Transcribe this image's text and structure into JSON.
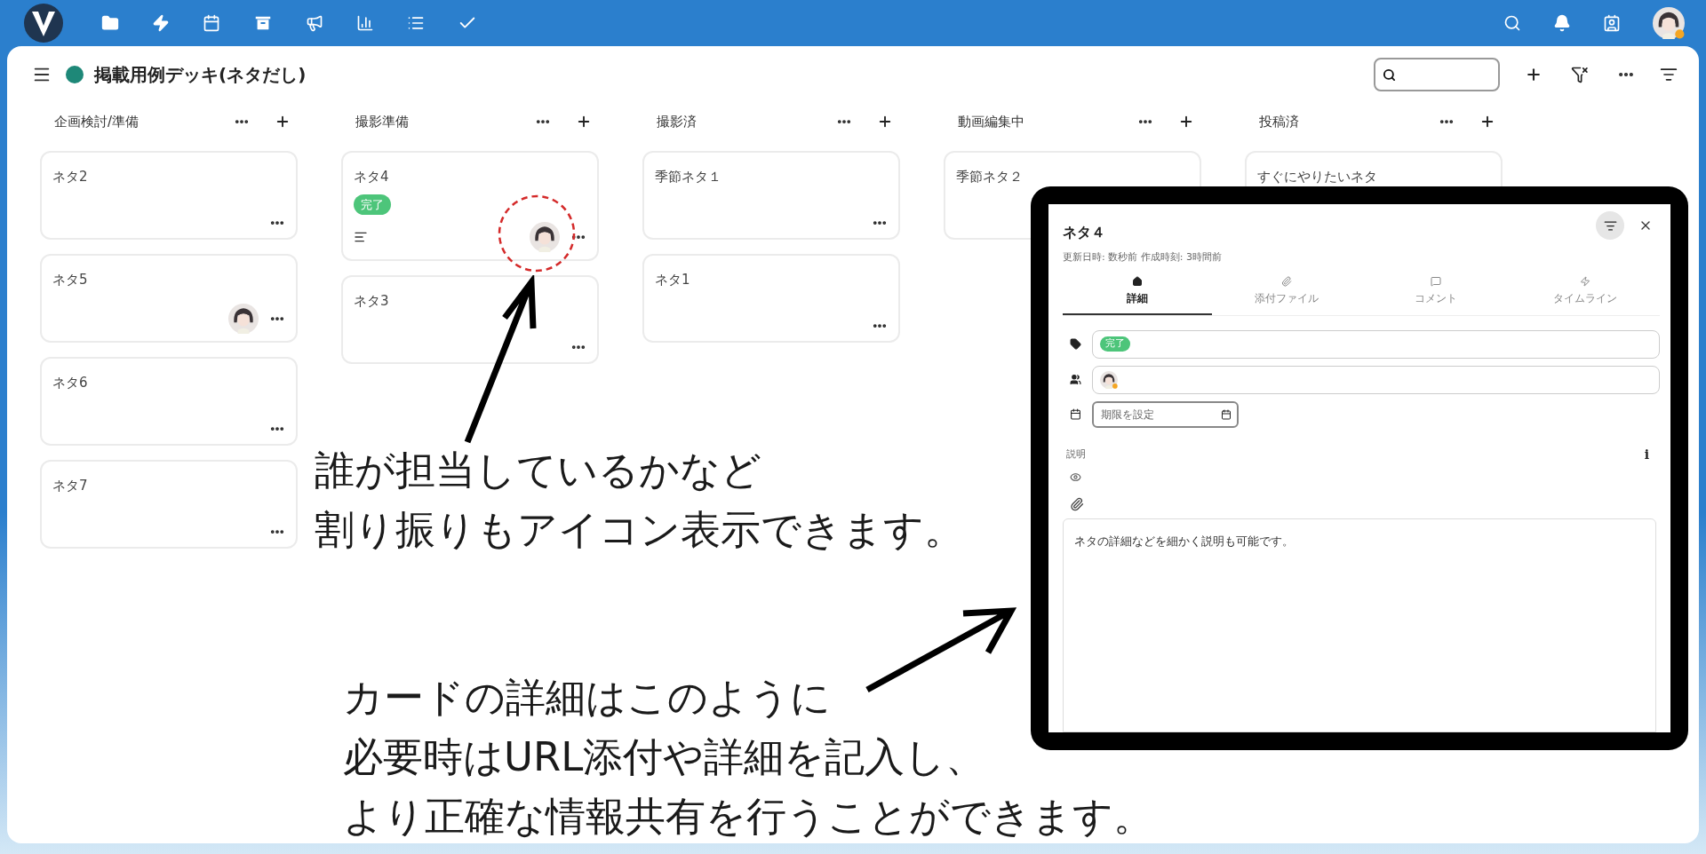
{
  "board": {
    "title": "掲載用例デッキ(ネタだし)"
  },
  "columns": [
    {
      "title": "企画検討/準備",
      "cards": [
        {
          "title": "ネタ2",
          "assigned": false,
          "has_description": false
        },
        {
          "title": "ネタ5",
          "assigned": true,
          "has_description": false
        },
        {
          "title": "ネタ6",
          "assigned": false,
          "has_description": false
        },
        {
          "title": "ネタ7",
          "assigned": false,
          "has_description": false
        }
      ]
    },
    {
      "title": "撮影準備",
      "cards": [
        {
          "title": "ネタ4",
          "labels": [
            "完了"
          ],
          "assigned": true,
          "has_description": true
        },
        {
          "title": "ネタ3",
          "assigned": false,
          "has_description": false
        }
      ]
    },
    {
      "title": "撮影済",
      "cards": [
        {
          "title": "季節ネタ１",
          "assigned": false,
          "has_description": false
        },
        {
          "title": "ネタ1",
          "assigned": false,
          "has_description": false
        }
      ]
    },
    {
      "title": "動画編集中",
      "cards": [
        {
          "title": "季節ネタ２"
        }
      ]
    },
    {
      "title": "投稿済",
      "cards": [
        {
          "title": "すぐにやりたいネタ"
        }
      ]
    }
  ],
  "detail": {
    "title": "ネタ４",
    "meta": "更新日時: 数秒前 作成時刻: 3時間前",
    "tabs": [
      {
        "label": "詳細",
        "selected": true
      },
      {
        "label": "添付ファイル",
        "selected": false
      },
      {
        "label": "コメント",
        "selected": false
      },
      {
        "label": "タイムライン",
        "selected": false
      }
    ],
    "labels": [
      "完了"
    ],
    "due_placeholder": "期限を設定",
    "description_label": "説明",
    "info": "i",
    "description": "ネタの詳細などを細かく説明も可能です。"
  },
  "annotations": [
    {
      "lines": [
        "誰が担当しているかなど",
        "割り振りもアイコン表示できます。"
      ]
    },
    {
      "lines": [
        "カードの詳細はこのように",
        "必要時はURL添付や詳細を記入し、",
        "より正確な情報共有を行うことができます。"
      ]
    }
  ]
}
